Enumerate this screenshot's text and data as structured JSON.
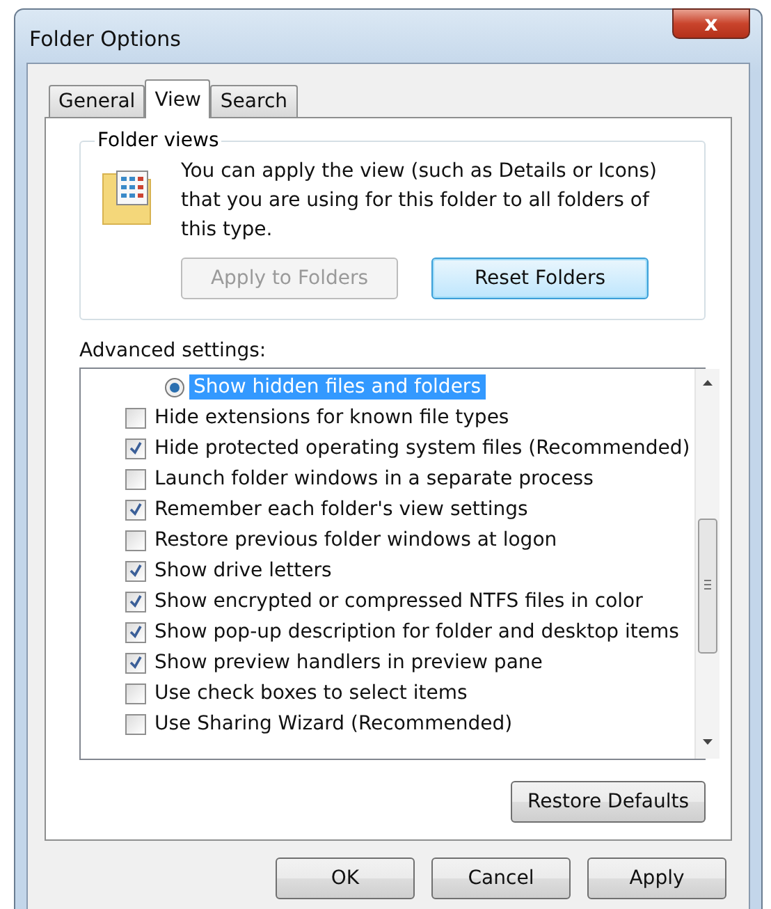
{
  "window": {
    "title": "Folder Options",
    "close": "x"
  },
  "tabs": [
    {
      "label": "General",
      "selected": false
    },
    {
      "label": "View",
      "selected": true
    },
    {
      "label": "Search",
      "selected": false
    }
  ],
  "folder_views": {
    "legend": "Folder views",
    "description": "You can apply the view (such as Details or Icons) that you are using for this folder to all folders of this type.",
    "buttons": [
      {
        "label": "Apply to Folders",
        "disabled": true,
        "focused": false
      },
      {
        "label": "Reset Folders",
        "disabled": false,
        "focused": true
      }
    ]
  },
  "advanced": {
    "label": "Advanced settings:",
    "items": [
      {
        "kind": "radio",
        "label": "Show hidden files and folders",
        "selected": true,
        "highlighted": true
      },
      {
        "kind": "checkbox",
        "label": "Hide extensions for known file types",
        "checked": false
      },
      {
        "kind": "checkbox",
        "label": "Hide protected operating system files (Recommended)",
        "checked": true
      },
      {
        "kind": "checkbox",
        "label": "Launch folder windows in a separate process",
        "checked": false
      },
      {
        "kind": "checkbox",
        "label": "Remember each folder's view settings",
        "checked": true
      },
      {
        "kind": "checkbox",
        "label": "Restore previous folder windows at logon",
        "checked": false
      },
      {
        "kind": "checkbox",
        "label": "Show drive letters",
        "checked": true
      },
      {
        "kind": "checkbox",
        "label": "Show encrypted or compressed NTFS files in color",
        "checked": true
      },
      {
        "kind": "checkbox",
        "label": "Show pop-up description for folder and desktop items",
        "checked": true
      },
      {
        "kind": "checkbox",
        "label": "Show preview handlers in preview pane",
        "checked": true
      },
      {
        "kind": "checkbox",
        "label": "Use check boxes to select items",
        "checked": false
      },
      {
        "kind": "checkbox",
        "label": "Use Sharing Wizard (Recommended)",
        "checked": false
      }
    ],
    "restore_button": "Restore Defaults"
  },
  "buttons": [
    "OK",
    "Cancel",
    "Apply"
  ]
}
